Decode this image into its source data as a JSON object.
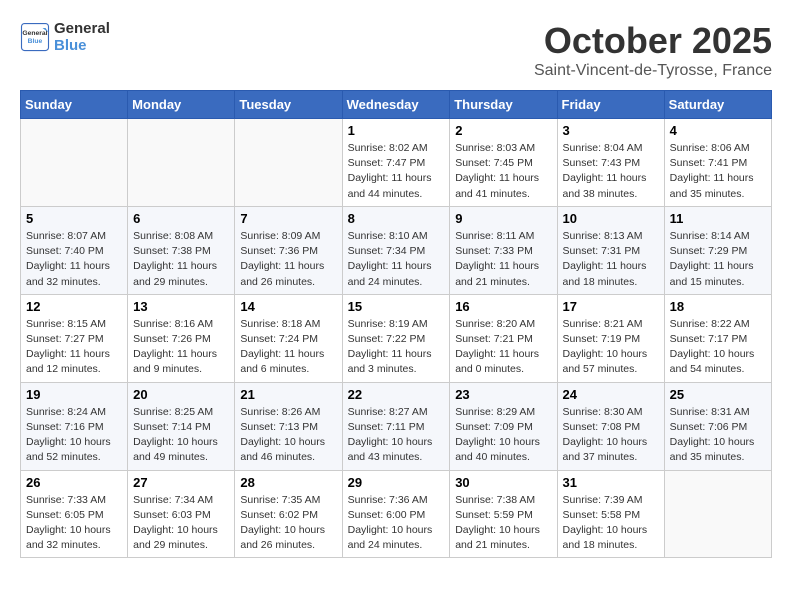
{
  "header": {
    "logo_general": "General",
    "logo_blue": "Blue",
    "month": "October 2025",
    "location": "Saint-Vincent-de-Tyrosse, France"
  },
  "weekdays": [
    "Sunday",
    "Monday",
    "Tuesday",
    "Wednesday",
    "Thursday",
    "Friday",
    "Saturday"
  ],
  "weeks": [
    [
      {
        "day": "",
        "info": ""
      },
      {
        "day": "",
        "info": ""
      },
      {
        "day": "",
        "info": ""
      },
      {
        "day": "1",
        "info": "Sunrise: 8:02 AM\nSunset: 7:47 PM\nDaylight: 11 hours\nand 44 minutes."
      },
      {
        "day": "2",
        "info": "Sunrise: 8:03 AM\nSunset: 7:45 PM\nDaylight: 11 hours\nand 41 minutes."
      },
      {
        "day": "3",
        "info": "Sunrise: 8:04 AM\nSunset: 7:43 PM\nDaylight: 11 hours\nand 38 minutes."
      },
      {
        "day": "4",
        "info": "Sunrise: 8:06 AM\nSunset: 7:41 PM\nDaylight: 11 hours\nand 35 minutes."
      }
    ],
    [
      {
        "day": "5",
        "info": "Sunrise: 8:07 AM\nSunset: 7:40 PM\nDaylight: 11 hours\nand 32 minutes."
      },
      {
        "day": "6",
        "info": "Sunrise: 8:08 AM\nSunset: 7:38 PM\nDaylight: 11 hours\nand 29 minutes."
      },
      {
        "day": "7",
        "info": "Sunrise: 8:09 AM\nSunset: 7:36 PM\nDaylight: 11 hours\nand 26 minutes."
      },
      {
        "day": "8",
        "info": "Sunrise: 8:10 AM\nSunset: 7:34 PM\nDaylight: 11 hours\nand 24 minutes."
      },
      {
        "day": "9",
        "info": "Sunrise: 8:11 AM\nSunset: 7:33 PM\nDaylight: 11 hours\nand 21 minutes."
      },
      {
        "day": "10",
        "info": "Sunrise: 8:13 AM\nSunset: 7:31 PM\nDaylight: 11 hours\nand 18 minutes."
      },
      {
        "day": "11",
        "info": "Sunrise: 8:14 AM\nSunset: 7:29 PM\nDaylight: 11 hours\nand 15 minutes."
      }
    ],
    [
      {
        "day": "12",
        "info": "Sunrise: 8:15 AM\nSunset: 7:27 PM\nDaylight: 11 hours\nand 12 minutes."
      },
      {
        "day": "13",
        "info": "Sunrise: 8:16 AM\nSunset: 7:26 PM\nDaylight: 11 hours\nand 9 minutes."
      },
      {
        "day": "14",
        "info": "Sunrise: 8:18 AM\nSunset: 7:24 PM\nDaylight: 11 hours\nand 6 minutes."
      },
      {
        "day": "15",
        "info": "Sunrise: 8:19 AM\nSunset: 7:22 PM\nDaylight: 11 hours\nand 3 minutes."
      },
      {
        "day": "16",
        "info": "Sunrise: 8:20 AM\nSunset: 7:21 PM\nDaylight: 11 hours\nand 0 minutes."
      },
      {
        "day": "17",
        "info": "Sunrise: 8:21 AM\nSunset: 7:19 PM\nDaylight: 10 hours\nand 57 minutes."
      },
      {
        "day": "18",
        "info": "Sunrise: 8:22 AM\nSunset: 7:17 PM\nDaylight: 10 hours\nand 54 minutes."
      }
    ],
    [
      {
        "day": "19",
        "info": "Sunrise: 8:24 AM\nSunset: 7:16 PM\nDaylight: 10 hours\nand 52 minutes."
      },
      {
        "day": "20",
        "info": "Sunrise: 8:25 AM\nSunset: 7:14 PM\nDaylight: 10 hours\nand 49 minutes."
      },
      {
        "day": "21",
        "info": "Sunrise: 8:26 AM\nSunset: 7:13 PM\nDaylight: 10 hours\nand 46 minutes."
      },
      {
        "day": "22",
        "info": "Sunrise: 8:27 AM\nSunset: 7:11 PM\nDaylight: 10 hours\nand 43 minutes."
      },
      {
        "day": "23",
        "info": "Sunrise: 8:29 AM\nSunset: 7:09 PM\nDaylight: 10 hours\nand 40 minutes."
      },
      {
        "day": "24",
        "info": "Sunrise: 8:30 AM\nSunset: 7:08 PM\nDaylight: 10 hours\nand 37 minutes."
      },
      {
        "day": "25",
        "info": "Sunrise: 8:31 AM\nSunset: 7:06 PM\nDaylight: 10 hours\nand 35 minutes."
      }
    ],
    [
      {
        "day": "26",
        "info": "Sunrise: 7:33 AM\nSunset: 6:05 PM\nDaylight: 10 hours\nand 32 minutes."
      },
      {
        "day": "27",
        "info": "Sunrise: 7:34 AM\nSunset: 6:03 PM\nDaylight: 10 hours\nand 29 minutes."
      },
      {
        "day": "28",
        "info": "Sunrise: 7:35 AM\nSunset: 6:02 PM\nDaylight: 10 hours\nand 26 minutes."
      },
      {
        "day": "29",
        "info": "Sunrise: 7:36 AM\nSunset: 6:00 PM\nDaylight: 10 hours\nand 24 minutes."
      },
      {
        "day": "30",
        "info": "Sunrise: 7:38 AM\nSunset: 5:59 PM\nDaylight: 10 hours\nand 21 minutes."
      },
      {
        "day": "31",
        "info": "Sunrise: 7:39 AM\nSunset: 5:58 PM\nDaylight: 10 hours\nand 18 minutes."
      },
      {
        "day": "",
        "info": ""
      }
    ]
  ]
}
